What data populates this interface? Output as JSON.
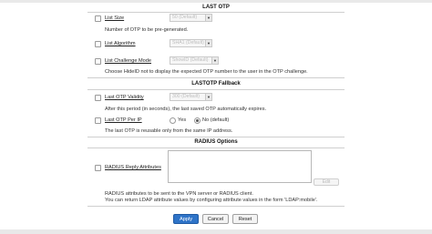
{
  "lastotp_section": {
    "title": "LAST OTP",
    "list_size": {
      "label": "List Size",
      "value": "50 (Default)"
    },
    "list_size_desc": "Number of OTP to be pre-generated.",
    "list_algorithm": {
      "label": "List Algorithm",
      "value": "SHA1 (Default)"
    },
    "list_challenge_mode": {
      "label": "List Challenge Mode",
      "value": "ShowID (Default)"
    },
    "list_challenge_desc": "Choose HideID not to display the expected OTP number to the user in the OTP challenge."
  },
  "fallback_section": {
    "title": "LASTOTP Fallback",
    "validity": {
      "label": "Last OTP Validity",
      "value": "300 (Default)"
    },
    "validity_desc": "After this period (in seconds), the last saved OTP automatically expires.",
    "per_ip": {
      "label": "Last OTP Per IP",
      "yes_label": "Yes",
      "no_label": "No (default)",
      "selected": "no"
    },
    "per_ip_desc": "The last OTP is reusable only from the same IP address."
  },
  "radius_section": {
    "title": "RADIUS Options",
    "reply_attributes": {
      "label": "RADIUS Reply Attributes",
      "value": "",
      "edit_label": "Edit"
    },
    "desc_1": "RADIUS attributes to be sent to the VPN server or RADIUS client.",
    "desc_2": "You can return LDAP attribute values by configuring attribute values in the form 'LDAP:mobile'."
  },
  "actions": {
    "apply": "Apply",
    "cancel": "Cancel",
    "reset": "Reset"
  },
  "colors": {
    "primary": "#2f74c8",
    "separator": "#cfcfcf"
  }
}
